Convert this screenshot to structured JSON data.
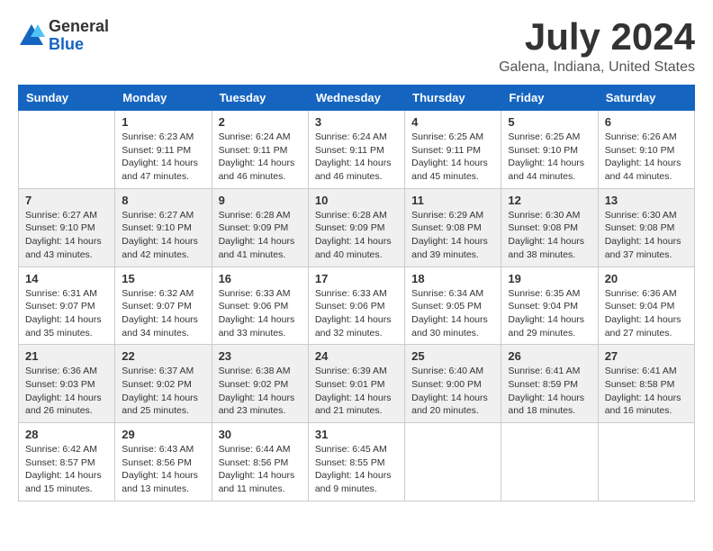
{
  "header": {
    "logo_general": "General",
    "logo_blue": "Blue",
    "month_title": "July 2024",
    "location": "Galena, Indiana, United States"
  },
  "calendar": {
    "days_of_week": [
      "Sunday",
      "Monday",
      "Tuesday",
      "Wednesday",
      "Thursday",
      "Friday",
      "Saturday"
    ],
    "weeks": [
      [
        {
          "day": "",
          "info": ""
        },
        {
          "day": "1",
          "info": "Sunrise: 6:23 AM\nSunset: 9:11 PM\nDaylight: 14 hours\nand 47 minutes."
        },
        {
          "day": "2",
          "info": "Sunrise: 6:24 AM\nSunset: 9:11 PM\nDaylight: 14 hours\nand 46 minutes."
        },
        {
          "day": "3",
          "info": "Sunrise: 6:24 AM\nSunset: 9:11 PM\nDaylight: 14 hours\nand 46 minutes."
        },
        {
          "day": "4",
          "info": "Sunrise: 6:25 AM\nSunset: 9:11 PM\nDaylight: 14 hours\nand 45 minutes."
        },
        {
          "day": "5",
          "info": "Sunrise: 6:25 AM\nSunset: 9:10 PM\nDaylight: 14 hours\nand 44 minutes."
        },
        {
          "day": "6",
          "info": "Sunrise: 6:26 AM\nSunset: 9:10 PM\nDaylight: 14 hours\nand 44 minutes."
        }
      ],
      [
        {
          "day": "7",
          "info": "Sunrise: 6:27 AM\nSunset: 9:10 PM\nDaylight: 14 hours\nand 43 minutes."
        },
        {
          "day": "8",
          "info": "Sunrise: 6:27 AM\nSunset: 9:10 PM\nDaylight: 14 hours\nand 42 minutes."
        },
        {
          "day": "9",
          "info": "Sunrise: 6:28 AM\nSunset: 9:09 PM\nDaylight: 14 hours\nand 41 minutes."
        },
        {
          "day": "10",
          "info": "Sunrise: 6:28 AM\nSunset: 9:09 PM\nDaylight: 14 hours\nand 40 minutes."
        },
        {
          "day": "11",
          "info": "Sunrise: 6:29 AM\nSunset: 9:08 PM\nDaylight: 14 hours\nand 39 minutes."
        },
        {
          "day": "12",
          "info": "Sunrise: 6:30 AM\nSunset: 9:08 PM\nDaylight: 14 hours\nand 38 minutes."
        },
        {
          "day": "13",
          "info": "Sunrise: 6:30 AM\nSunset: 9:08 PM\nDaylight: 14 hours\nand 37 minutes."
        }
      ],
      [
        {
          "day": "14",
          "info": "Sunrise: 6:31 AM\nSunset: 9:07 PM\nDaylight: 14 hours\nand 35 minutes."
        },
        {
          "day": "15",
          "info": "Sunrise: 6:32 AM\nSunset: 9:07 PM\nDaylight: 14 hours\nand 34 minutes."
        },
        {
          "day": "16",
          "info": "Sunrise: 6:33 AM\nSunset: 9:06 PM\nDaylight: 14 hours\nand 33 minutes."
        },
        {
          "day": "17",
          "info": "Sunrise: 6:33 AM\nSunset: 9:06 PM\nDaylight: 14 hours\nand 32 minutes."
        },
        {
          "day": "18",
          "info": "Sunrise: 6:34 AM\nSunset: 9:05 PM\nDaylight: 14 hours\nand 30 minutes."
        },
        {
          "day": "19",
          "info": "Sunrise: 6:35 AM\nSunset: 9:04 PM\nDaylight: 14 hours\nand 29 minutes."
        },
        {
          "day": "20",
          "info": "Sunrise: 6:36 AM\nSunset: 9:04 PM\nDaylight: 14 hours\nand 27 minutes."
        }
      ],
      [
        {
          "day": "21",
          "info": "Sunrise: 6:36 AM\nSunset: 9:03 PM\nDaylight: 14 hours\nand 26 minutes."
        },
        {
          "day": "22",
          "info": "Sunrise: 6:37 AM\nSunset: 9:02 PM\nDaylight: 14 hours\nand 25 minutes."
        },
        {
          "day": "23",
          "info": "Sunrise: 6:38 AM\nSunset: 9:02 PM\nDaylight: 14 hours\nand 23 minutes."
        },
        {
          "day": "24",
          "info": "Sunrise: 6:39 AM\nSunset: 9:01 PM\nDaylight: 14 hours\nand 21 minutes."
        },
        {
          "day": "25",
          "info": "Sunrise: 6:40 AM\nSunset: 9:00 PM\nDaylight: 14 hours\nand 20 minutes."
        },
        {
          "day": "26",
          "info": "Sunrise: 6:41 AM\nSunset: 8:59 PM\nDaylight: 14 hours\nand 18 minutes."
        },
        {
          "day": "27",
          "info": "Sunrise: 6:41 AM\nSunset: 8:58 PM\nDaylight: 14 hours\nand 16 minutes."
        }
      ],
      [
        {
          "day": "28",
          "info": "Sunrise: 6:42 AM\nSunset: 8:57 PM\nDaylight: 14 hours\nand 15 minutes."
        },
        {
          "day": "29",
          "info": "Sunrise: 6:43 AM\nSunset: 8:56 PM\nDaylight: 14 hours\nand 13 minutes."
        },
        {
          "day": "30",
          "info": "Sunrise: 6:44 AM\nSunset: 8:56 PM\nDaylight: 14 hours\nand 11 minutes."
        },
        {
          "day": "31",
          "info": "Sunrise: 6:45 AM\nSunset: 8:55 PM\nDaylight: 14 hours\nand 9 minutes."
        },
        {
          "day": "",
          "info": ""
        },
        {
          "day": "",
          "info": ""
        },
        {
          "day": "",
          "info": ""
        }
      ]
    ]
  }
}
